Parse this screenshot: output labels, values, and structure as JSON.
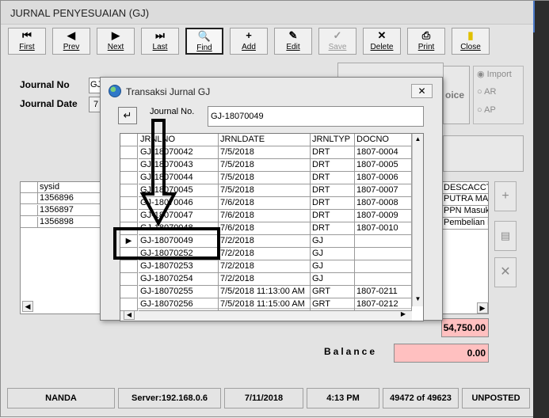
{
  "main": {
    "title": "JURNAL PENYESUAIAN (GJ)",
    "toolbar": [
      {
        "label": "First",
        "icon": "first-icon",
        "glyph": "⏮",
        "enabled": true
      },
      {
        "label": "Prev",
        "icon": "prev-icon",
        "glyph": "◀",
        "enabled": true
      },
      {
        "label": "Next",
        "icon": "next-icon",
        "glyph": "▶",
        "enabled": true
      },
      {
        "label": "Last",
        "icon": "last-icon",
        "glyph": "⏭",
        "enabled": true
      },
      {
        "label": "Find",
        "icon": "search-icon",
        "glyph": "🔍",
        "enabled": true
      },
      {
        "label": "Add",
        "icon": "add-icon",
        "glyph": "+",
        "enabled": true
      },
      {
        "label": "Edit",
        "icon": "edit-icon",
        "glyph": "✎",
        "enabled": true
      },
      {
        "label": "Save",
        "icon": "save-icon",
        "glyph": "✓",
        "enabled": false
      },
      {
        "label": "Delete",
        "icon": "delete-icon",
        "glyph": "✕",
        "enabled": true
      },
      {
        "label": "Print",
        "icon": "print-icon",
        "glyph": "⎙",
        "enabled": true
      },
      {
        "label": "Close",
        "icon": "close-door-icon",
        "glyph": "▮",
        "enabled": true
      }
    ],
    "journal_no_label": "Journal No",
    "journal_no_value": "GJ",
    "journal_date_label": "Journal Date",
    "journal_date_value": "7",
    "invoice_partial": "oice",
    "radio_import": "Import",
    "radio_ar": "AR",
    "radio_ap": "AP",
    "left_grid": {
      "header": "sysid",
      "rows": [
        "1356896",
        "1356897",
        "1356898"
      ]
    },
    "right_grid": {
      "header": "DESCACCT",
      "rows": [
        "PUTRA MAN",
        "PPN Masuka",
        "Pembelian B"
      ]
    },
    "total_value": "54,750.00",
    "balance_label": "Balance",
    "balance_value": "0.00"
  },
  "status": {
    "user": "NANDA",
    "server": "Server:192.168.0.6",
    "date": "7/11/2018",
    "time": "4:13 PM",
    "record": "49472 of 49623",
    "state": "UNPOSTED"
  },
  "dialog": {
    "title": "Transaksi Jurnal GJ",
    "journal_no_label": "Journal No.",
    "journal_no_value": "GJ-18070049",
    "columns": [
      "JRNLNO",
      "JRNLDATE",
      "JRNLTYP",
      "DOCNO"
    ],
    "rows": [
      [
        "GJ-18070042",
        "7/5/2018",
        "DRT",
        "1807-0004"
      ],
      [
        "GJ-18070043",
        "7/5/2018",
        "DRT",
        "1807-0005"
      ],
      [
        "GJ-18070044",
        "7/5/2018",
        "DRT",
        "1807-0006"
      ],
      [
        "GJ-18070045",
        "7/5/2018",
        "DRT",
        "1807-0007"
      ],
      [
        "GJ-18070046",
        "7/6/2018",
        "DRT",
        "1807-0008"
      ],
      [
        "GJ-18070047",
        "7/6/2018",
        "DRT",
        "1807-0009"
      ],
      [
        "GJ-18070048",
        "7/6/2018",
        "DRT",
        "1807-0010"
      ],
      [
        "GJ-18070049",
        "7/2/2018",
        "GJ",
        ""
      ],
      [
        "GJ-18070252",
        "7/2/2018",
        "GJ",
        ""
      ],
      [
        "GJ-18070253",
        "7/2/2018",
        "GJ",
        ""
      ],
      [
        "GJ-18070254",
        "7/2/2018",
        "GJ",
        ""
      ],
      [
        "GJ-18070255",
        "7/5/2018 11:13:00 AM",
        "GRT",
        "1807-0211"
      ],
      [
        "GJ-18070256",
        "7/5/2018 11:15:00 AM",
        "GRT",
        "1807-0212"
      ]
    ],
    "selected_row": 7
  }
}
